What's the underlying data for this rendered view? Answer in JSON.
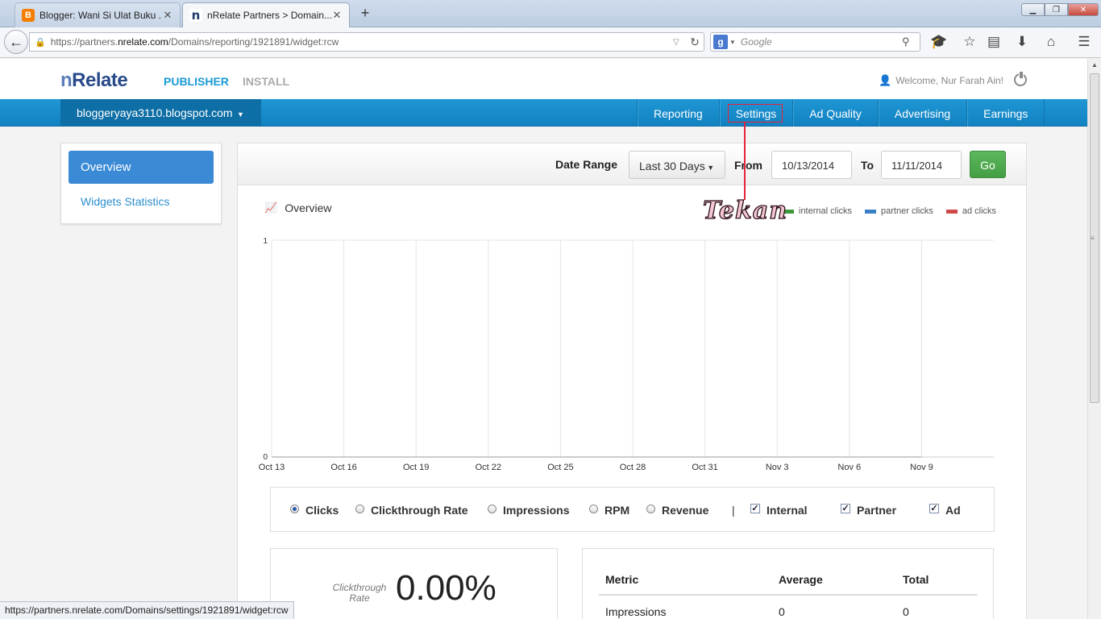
{
  "browser": {
    "tabs": [
      {
        "title": "Blogger: Wani Si Ulat Buku ...",
        "icon": "blogger-icon",
        "active": false
      },
      {
        "title": "nRelate Partners > Domain...",
        "icon": "nrelate-icon",
        "active": true
      }
    ],
    "url_prefix": "https://partners.",
    "url_domain": "nrelate.com",
    "url_path": "/Domains/reporting/1921891/widget:rcw",
    "search_placeholder": "Google",
    "status_url": "https://partners.nrelate.com/Domains/settings/1921891/widget:rcw"
  },
  "header": {
    "logo_n": "n",
    "logo_rest": "Relate",
    "nav_publisher": "PUBLISHER",
    "nav_install": "INSTALL",
    "welcome": "Welcome, Nur Farah Ain!"
  },
  "bluebar": {
    "domain": "bloggeryaya3110.blogspot.com",
    "menu": [
      "Reporting",
      "Settings",
      "Ad Quality",
      "Advertising",
      "Earnings"
    ]
  },
  "sidebar": {
    "overview": "Overview",
    "widgets": "Widgets Statistics"
  },
  "filters": {
    "date_range_label": "Date Range",
    "range_value": "Last 30 Days",
    "from_label": "From",
    "from_value": "10/13/2014",
    "to_label": "To",
    "to_value": "11/11/2014",
    "go_label": "Go"
  },
  "chart_section": {
    "title": "Overview",
    "legend": [
      {
        "label": "internal clicks",
        "color": "#3c9a3c"
      },
      {
        "label": "partner clicks",
        "color": "#3a80c8"
      },
      {
        "label": "ad clicks",
        "color": "#d04a4a"
      }
    ]
  },
  "chart_data": {
    "type": "line",
    "x": [
      "Oct 13",
      "Oct 16",
      "Oct 19",
      "Oct 22",
      "Oct 25",
      "Oct 28",
      "Oct 31",
      "Nov 3",
      "Nov 6",
      "Nov 9"
    ],
    "ylim": [
      0,
      1
    ],
    "yticks": [
      "1",
      "0"
    ],
    "series": [
      {
        "name": "internal clicks",
        "values": [
          0,
          0,
          0,
          0,
          0,
          0,
          0,
          0,
          0,
          0
        ]
      },
      {
        "name": "partner clicks",
        "values": [
          0,
          0,
          0,
          0,
          0,
          0,
          0,
          0,
          0,
          0
        ]
      },
      {
        "name": "ad clicks",
        "values": [
          0,
          0,
          0,
          0,
          0,
          0,
          0,
          0,
          0,
          0
        ]
      }
    ],
    "grid": true,
    "legend_position": "top-right"
  },
  "metric_options": {
    "radios": [
      "Clicks",
      "Clickthrough Rate",
      "Impressions",
      "RPM",
      "Revenue"
    ],
    "selected": "Clicks",
    "separator": "|",
    "checks": [
      "Internal",
      "Partner",
      "Ad"
    ],
    "check_mark": "✓"
  },
  "ctr": {
    "label": "Clickthrough Rate",
    "value": "0.00%"
  },
  "metric_table": {
    "headers": [
      "Metric",
      "Average",
      "Total"
    ],
    "rows": [
      [
        "Impressions",
        "0",
        "0"
      ]
    ]
  },
  "annotation": {
    "text": "Tekan"
  }
}
